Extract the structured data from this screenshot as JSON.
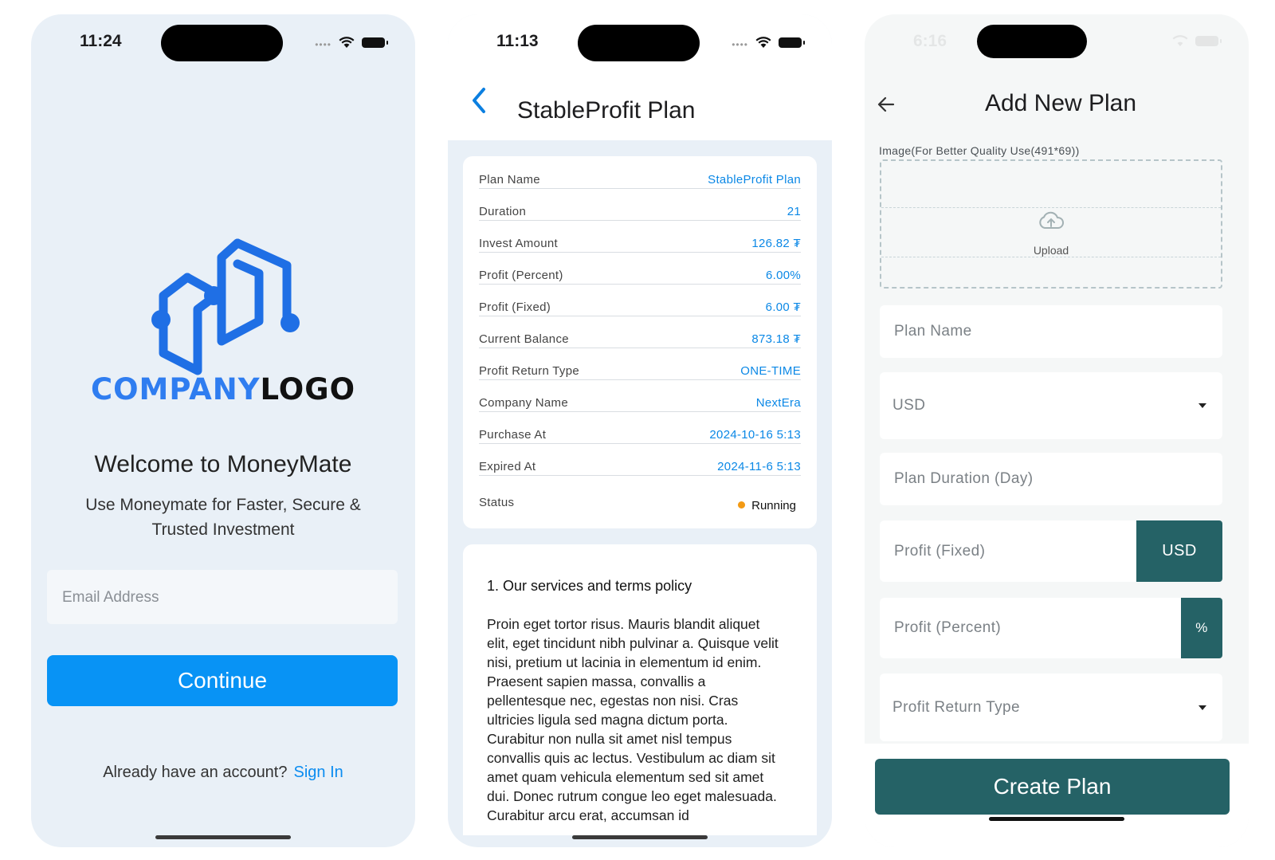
{
  "screen1": {
    "time": "11:24",
    "logo": {
      "company": "COMPANY",
      "logo": "LOGO"
    },
    "welcome": "Welcome to MoneyMate",
    "tagline": "Use Moneymate for Faster, Secure & Trusted Investment",
    "email_placeholder": "Email Address",
    "continue_label": "Continue",
    "account_prompt": "Already have an account?",
    "signin_label": "Sign In"
  },
  "screen2": {
    "time": "11:13",
    "title": "StableProfit Plan",
    "details": [
      {
        "label": "Plan Name",
        "value": "StableProfit Plan"
      },
      {
        "label": "Duration",
        "value": "21"
      },
      {
        "label": "Invest Amount",
        "value": "126.82 ₮"
      },
      {
        "label": "Profit (Percent)",
        "value": "6.00%"
      },
      {
        "label": "Profit (Fixed)",
        "value": "6.00 ₮"
      },
      {
        "label": "Current Balance",
        "value": "873.18 ₮"
      },
      {
        "label": "Profit Return Type",
        "value": "ONE-TIME"
      },
      {
        "label": "Company Name",
        "value": "NextEra"
      },
      {
        "label": "Purchase At",
        "value": "2024-10-16 5:13"
      },
      {
        "label": "Expired At",
        "value": "2024-11-6 5:13"
      }
    ],
    "status": {
      "label": "Status",
      "value": "Running",
      "color": "#f39a14"
    },
    "terms_heading": "1. Our services and terms policy",
    "terms_body": "Proin eget tortor risus. Mauris blandit aliquet elit, eget tincidunt nibh pulvinar a. Quisque velit nisi, pretium ut lacinia in elementum id enim. Praesent sapien massa, convallis a pellentesque nec, egestas non nisi. Cras ultricies ligula sed magna dictum porta. Curabitur non nulla sit amet nisl tempus convallis quis ac lectus. Vestibulum ac diam sit amet quam vehicula elementum sed sit amet dui. Donec rutrum congue leo eget malesuada. Curabitur arcu erat, accumsan id"
  },
  "screen3": {
    "time": "6:16",
    "title": "Add New Plan",
    "image_label": "Image(For Better Quality Use(491*69))",
    "upload_label": "Upload",
    "plan_name_placeholder": "Plan Name",
    "currency_value": "USD",
    "duration_placeholder": "Plan Duration (Day)",
    "profit_fixed_placeholder": "Profit (Fixed)",
    "profit_fixed_suffix": "USD",
    "profit_percent_placeholder": "Profit (Percent)",
    "profit_percent_suffix": "%",
    "return_type_placeholder": "Profit Return Type",
    "create_label": "Create Plan"
  },
  "colors": {
    "primary_blue": "#0893f5",
    "accent_teal": "#256266",
    "link_blue": "#0b88e6",
    "logo_blue": "#2f7df0"
  }
}
